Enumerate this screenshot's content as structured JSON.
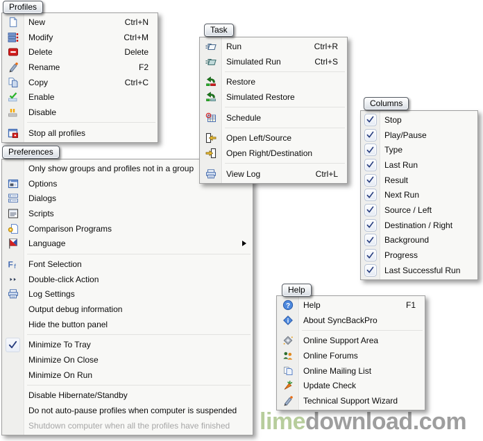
{
  "watermark": {
    "prefix": "lime",
    "suffix": "download.com",
    "prefix_color": "#b7cd9c",
    "suffix_color": "#9e9e9e"
  },
  "colors": {
    "check": "#263c7e",
    "menu_background": "#f8f8f6",
    "gutter_background": "#efefed",
    "menu_border": "#a0a0a0",
    "disabled_text": "#a6a6a6"
  },
  "menus": {
    "profiles": {
      "tab": "Profiles",
      "items": [
        {
          "label": "New",
          "shortcut": "Ctrl+N",
          "icon": "new-document"
        },
        {
          "label": "Modify",
          "shortcut": "Ctrl+M",
          "icon": "modify-profile"
        },
        {
          "label": "Delete",
          "shortcut": "Delete",
          "icon": "delete"
        },
        {
          "label": "Rename",
          "shortcut": "F2",
          "icon": "rename-pencil"
        },
        {
          "label": "Copy",
          "shortcut": "Ctrl+C",
          "icon": "copy-pages"
        },
        {
          "label": "Enable",
          "icon": "enable-check"
        },
        {
          "label": "Disable",
          "icon": "disable-pause"
        },
        {
          "separator": true
        },
        {
          "label": "Stop all profiles",
          "icon": "stop-all-profiles"
        }
      ]
    },
    "task": {
      "tab": "Task",
      "items": [
        {
          "label": "Run",
          "shortcut": "Ctrl+R",
          "icon": "run-folder"
        },
        {
          "label": "Simulated Run",
          "shortcut": "Ctrl+S",
          "icon": "simulated-run-folder"
        },
        {
          "separator": true
        },
        {
          "label": "Restore",
          "icon": "restore-arrow"
        },
        {
          "label": "Simulated Restore",
          "icon": "simulated-restore-arrow"
        },
        {
          "separator": true
        },
        {
          "label": "Schedule",
          "icon": "schedule-calendar"
        },
        {
          "separator": true
        },
        {
          "label": "Open Left/Source",
          "icon": "open-left-folder"
        },
        {
          "label": "Open Right/Destination",
          "icon": "open-right-folder"
        },
        {
          "separator": true
        },
        {
          "label": "View Log",
          "shortcut": "Ctrl+L",
          "icon": "view-log-printer"
        }
      ]
    },
    "columns": {
      "tab": "Columns",
      "items": [
        {
          "label": "Stop",
          "checkbox": true,
          "checked": true
        },
        {
          "label": "Play/Pause",
          "checkbox": true,
          "checked": true
        },
        {
          "label": "Type",
          "checkbox": true,
          "checked": true
        },
        {
          "label": "Last Run",
          "checkbox": true,
          "checked": true
        },
        {
          "label": "Result",
          "checkbox": true,
          "checked": true
        },
        {
          "label": "Next Run",
          "checkbox": true,
          "checked": true
        },
        {
          "label": "Source / Left",
          "checkbox": true,
          "checked": true
        },
        {
          "label": "Destination / Right",
          "checkbox": true,
          "checked": true
        },
        {
          "label": "Background",
          "checkbox": true,
          "checked": true
        },
        {
          "label": "Progress",
          "checkbox": true,
          "checked": true
        },
        {
          "label": "Last Successful Run",
          "checkbox": true,
          "checked": true
        }
      ]
    },
    "preferences": {
      "tab": "Preferences",
      "items": [
        {
          "label": "Only show groups and profiles not in a group"
        },
        {
          "label": "Options",
          "icon": "options-window"
        },
        {
          "label": "Dialogs",
          "icon": "dialogs-window"
        },
        {
          "label": "Scripts",
          "icon": "scripts-window"
        },
        {
          "label": "Comparison Programs",
          "icon": "comparison-programs"
        },
        {
          "label": "Language",
          "icon": "language-flag",
          "submenu": true
        },
        {
          "separator": true
        },
        {
          "label": "Font Selection",
          "icon": "font-selection"
        },
        {
          "label": "Double-click Action",
          "icon": "double-click-arrows"
        },
        {
          "label": "Log Settings",
          "icon": "log-settings-printer"
        },
        {
          "label": "Output debug information"
        },
        {
          "label": "Hide the button panel"
        },
        {
          "separator": true
        },
        {
          "label": "Minimize To Tray",
          "checked": true
        },
        {
          "label": "Minimize On Close"
        },
        {
          "label": "Minimize On Run"
        },
        {
          "separator": true
        },
        {
          "label": "Disable Hibernate/Standby"
        },
        {
          "label": "Do not auto-pause profiles when computer is suspended"
        },
        {
          "label": "Shutdown computer when all the profiles have finished",
          "disabled": true
        }
      ]
    },
    "help": {
      "tab": "Help",
      "items": [
        {
          "label": "Help",
          "shortcut": "F1",
          "icon": "help-circle"
        },
        {
          "label": "About SyncBackPro",
          "icon": "about-info-diamond"
        },
        {
          "separator": true
        },
        {
          "label": "Online Support Area",
          "icon": "online-support-diamond"
        },
        {
          "label": "Online Forums",
          "icon": "online-forums-people"
        },
        {
          "label": "Online Mailing List",
          "icon": "mailing-list-pages"
        },
        {
          "label": "Update Check",
          "icon": "update-check-carrot"
        },
        {
          "label": "Technical Support Wizard",
          "icon": "tech-support-pencil"
        }
      ]
    }
  }
}
